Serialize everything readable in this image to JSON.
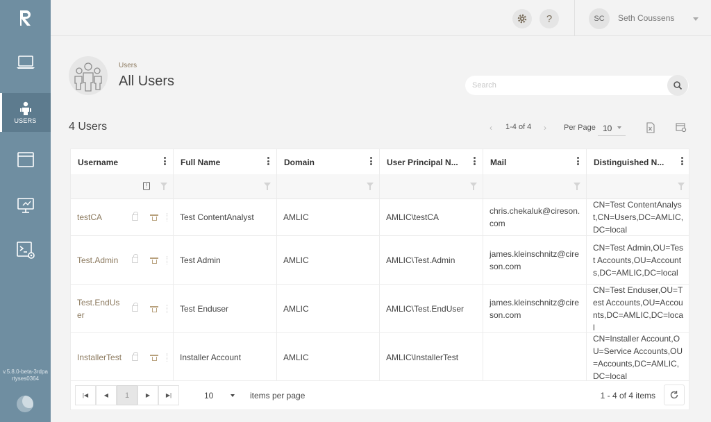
{
  "sidebar": {
    "logo": "R",
    "items": [
      {
        "name": "laptop-icon",
        "label": ""
      },
      {
        "name": "users-icon",
        "label": "USERS"
      },
      {
        "name": "window-icon",
        "label": ""
      },
      {
        "name": "monitor-icon",
        "label": ""
      },
      {
        "name": "terminal-settings-icon",
        "label": ""
      }
    ],
    "version": "v.5.8.0-beta-3rdpartyses0364"
  },
  "topbar": {
    "settings_icon": "gear-icon",
    "help_icon": "?",
    "user_initials": "SC",
    "user_name": "Seth Coussens"
  },
  "header": {
    "breadcrumb": "Users",
    "title": "All Users",
    "search_placeholder": "Search"
  },
  "toolbar": {
    "count": "4 Users",
    "range": "1-4 of 4",
    "per_page_label": "Per Page",
    "per_page_value": "10"
  },
  "grid": {
    "columns": [
      "Username",
      "Full Name",
      "Domain",
      "User Principal N...",
      "Mail",
      "Distinguished N..."
    ],
    "rows": [
      {
        "username": "testCA",
        "full_name": "Test ContentAnalyst",
        "domain": "AMLIC",
        "upn": "AMLIC\\testCA",
        "mail": "chris.chekaluk@cireson.com",
        "dn": "CN=Test ContentAnalyst,CN=Users,DC=AMLIC,DC=local"
      },
      {
        "username": "Test.Admin",
        "full_name": "Test Admin",
        "domain": "AMLIC",
        "upn": "AMLIC\\Test.Admin",
        "mail": "james.kleinschnitz@cireson.com",
        "dn": "CN=Test Admin,OU=Test Accounts,OU=Accounts,DC=AMLIC,DC=local"
      },
      {
        "username": "Test.EndUser",
        "full_name": "Test Enduser",
        "domain": "AMLIC",
        "upn": "AMLIC\\Test.EndUser",
        "mail": "james.kleinschnitz@cireson.com",
        "dn": "CN=Test Enduser,OU=Test Accounts,OU=Accounts,DC=AMLIC,DC=local"
      },
      {
        "username": "InstallerTest",
        "full_name": "Installer Account",
        "domain": "AMLIC",
        "upn": "AMLIC\\InstallerTest",
        "mail": "",
        "dn": "CN=Installer Account,OU=Service Accounts,OU=Accounts,DC=AMLIC,DC=local"
      }
    ]
  },
  "footer": {
    "current_page": "1",
    "page_size": "10",
    "items_per_page_label": "items per page",
    "range_label": "1 - 4 of 4 items"
  },
  "colors": {
    "sidebar": "#6f8ea1",
    "accent": "#8c7a5f",
    "background": "#f3f3f3"
  }
}
